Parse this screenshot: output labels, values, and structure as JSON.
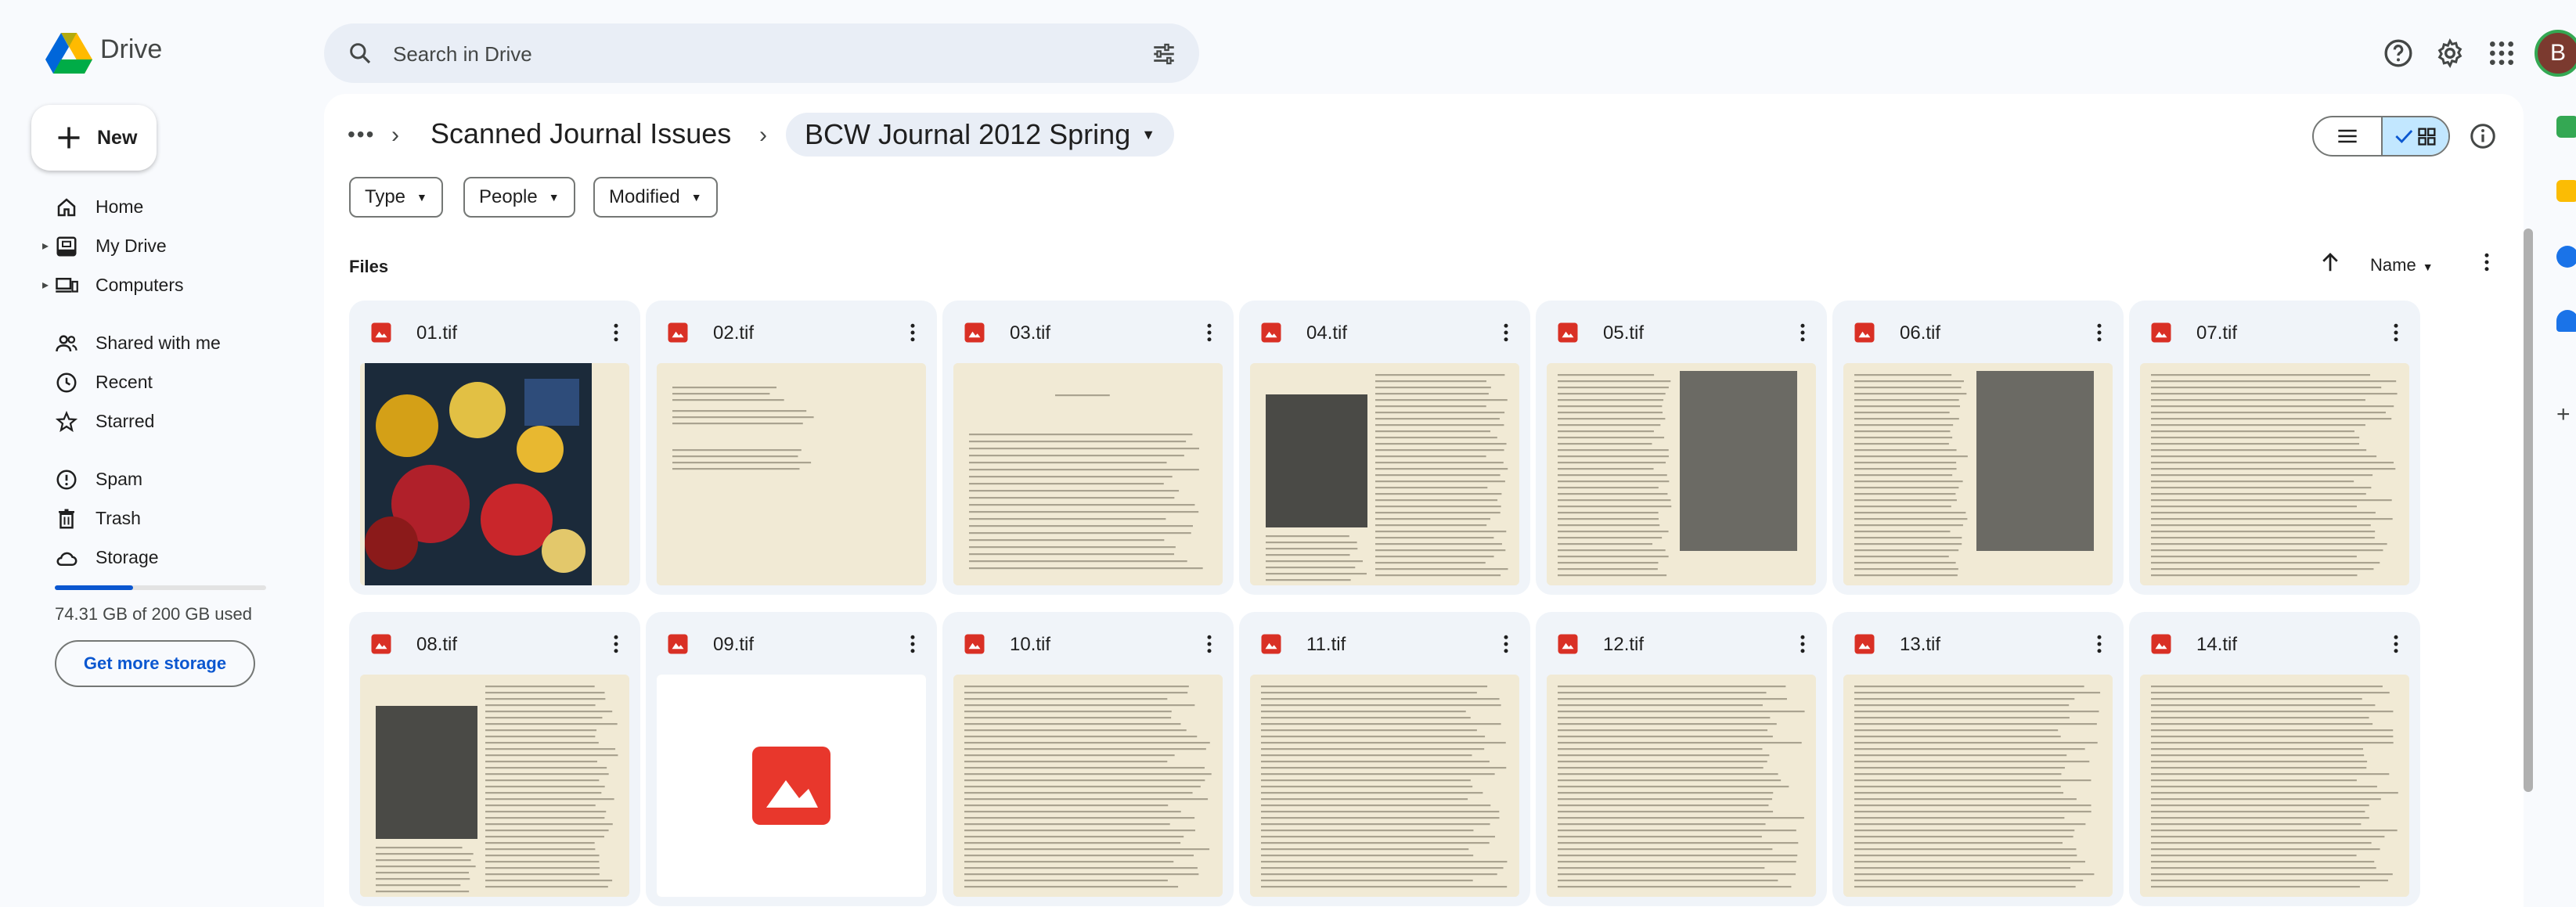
{
  "app": {
    "brand": "Drive",
    "search_placeholder": "Search in Drive",
    "avatar_letter": "B"
  },
  "sidebar": {
    "new_label": "New",
    "items": [
      {
        "label": "Home",
        "icon": "home-icon",
        "caret": false
      },
      {
        "label": "My Drive",
        "icon": "drive-icon",
        "caret": true
      },
      {
        "label": "Computers",
        "icon": "computer-icon",
        "caret": true
      },
      {
        "label": "Shared with me",
        "icon": "shared-icon",
        "caret": false
      },
      {
        "label": "Recent",
        "icon": "clock-icon",
        "caret": false
      },
      {
        "label": "Starred",
        "icon": "star-icon",
        "caret": false
      },
      {
        "label": "Spam",
        "icon": "spam-icon",
        "caret": false
      },
      {
        "label": "Trash",
        "icon": "trash-icon",
        "caret": false
      },
      {
        "label": "Storage",
        "icon": "cloud-icon",
        "caret": false
      }
    ],
    "storage": {
      "used_text": "74.31 GB of 200 GB used",
      "used_fraction": 0.37,
      "button_label": "Get more storage"
    }
  },
  "breadcrumb": {
    "more": "•••",
    "parent": "Scanned Journal Issues",
    "current": "BCW Journal 2012 Spring"
  },
  "filters": [
    "Type",
    "People",
    "Modified"
  ],
  "files_section": {
    "title": "Files",
    "sort_label": "Name"
  },
  "files": [
    {
      "name": "01.tif",
      "thumb": "cover"
    },
    {
      "name": "02.tif",
      "thumb": "text-sparse"
    },
    {
      "name": "03.tif",
      "thumb": "text-editor"
    },
    {
      "name": "04.tif",
      "thumb": "text-image-left"
    },
    {
      "name": "05.tif",
      "thumb": "text-image-right"
    },
    {
      "name": "06.tif",
      "thumb": "text-image-right"
    },
    {
      "name": "07.tif",
      "thumb": "text"
    },
    {
      "name": "08.tif",
      "thumb": "text-image-left"
    },
    {
      "name": "09.tif",
      "thumb": "placeholder"
    },
    {
      "name": "10.tif",
      "thumb": "text"
    },
    {
      "name": "11.tif",
      "thumb": "text"
    },
    {
      "name": "12.tif",
      "thumb": "text"
    },
    {
      "name": "13.tif",
      "thumb": "text"
    },
    {
      "name": "14.tif",
      "thumb": "text"
    }
  ],
  "colors": {
    "accent": "#0b57d0",
    "image_file_red": "#d93025",
    "selected_toggle": "#c2e7ff",
    "page_paper": "#f1ead5"
  }
}
